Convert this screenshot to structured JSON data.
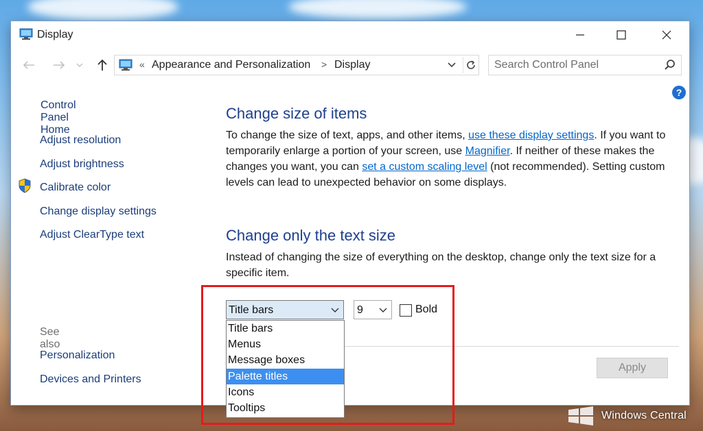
{
  "window": {
    "title": "Display",
    "controls": {
      "minimize": "—",
      "maximize": "☐",
      "close": "✕"
    }
  },
  "address_bar": {
    "overflow_chevron": "«",
    "crumbs": [
      "Appearance and Personalization",
      "Display"
    ],
    "separator": ">"
  },
  "search": {
    "placeholder": "Search Control Panel"
  },
  "help": {
    "label": "?"
  },
  "sidebar": {
    "home": "Control Panel Home",
    "links": [
      "Adjust resolution",
      "Adjust brightness",
      "Calibrate color",
      "Change display settings",
      "Adjust ClearType text"
    ],
    "see_also_heading": "See also",
    "see_also": [
      "Personalization",
      "Devices and Printers"
    ]
  },
  "main": {
    "section1": {
      "heading": "Change size of items",
      "p1": "To change the size of text, apps, and other items,",
      "link1": "use these display settings",
      "p2": ". If you want to temporarily enlarge a portion of your screen, use",
      "link2": "Magnifier",
      "p3": ". If neither of these makes the changes you want, you can",
      "link3": "set a custom scaling level",
      "p4": "(not recommended). Setting custom levels can lead to unexpected behavior on some displays."
    },
    "section2": {
      "heading": "Change only the text size",
      "description": "Instead of changing the size of everything on the desktop, change only the text size for a specific item."
    },
    "item_combo": {
      "selected": "Title bars",
      "options": [
        "Title bars",
        "Menus",
        "Message boxes",
        "Palette titles",
        "Icons",
        "Tooltips"
      ],
      "highlighted": "Palette titles"
    },
    "size_combo": {
      "selected": "9"
    },
    "bold_checkbox": {
      "label": "Bold",
      "checked": false
    },
    "apply_label": "Apply"
  },
  "watermark": {
    "text": "Windows Central"
  },
  "colors": {
    "heading": "#1e3f8e",
    "link": "#0066cc",
    "sidebar_link": "#1a3d7a",
    "selection": "#3c8ff0",
    "callout": "#e51b1b"
  }
}
